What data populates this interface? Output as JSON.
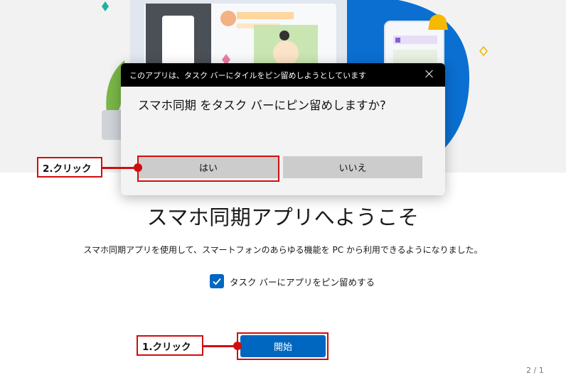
{
  "dialog": {
    "title": "このアプリは、タスク バーにタイルをピン留めしようとしています",
    "message": "スマホ同期 をタスク バーにピン留めしますか?",
    "yes_label": "はい",
    "no_label": "いいえ"
  },
  "welcome": {
    "title": "スマホ同期アプリへようこそ",
    "description": "スマホ同期アプリを使用して、スマートフォンのあらゆる機能を PC から利用できるようになりました。",
    "pin_checkbox": {
      "label": "タスク バーにアプリをピン留めする",
      "checked": true
    },
    "start_label": "開始",
    "page_indicator": "2 / 1"
  },
  "annotations": {
    "step1_label": "1.クリック",
    "step2_label": "2.クリック",
    "highlight_color": "#d10e0e"
  },
  "colors": {
    "accent": "#0067c0",
    "dialog_titlebar": "#000000",
    "dialog_button": "#cccccc",
    "hero_background": "#f2f2f2"
  }
}
